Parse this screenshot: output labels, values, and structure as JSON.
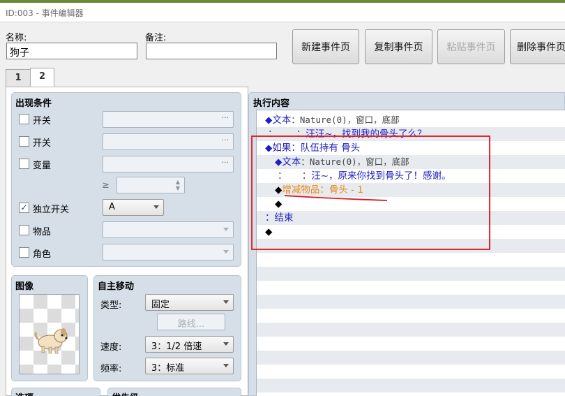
{
  "window": {
    "title": "ID:003 - 事件编辑器"
  },
  "header": {
    "name_label": "名称:",
    "name_value": "狗子",
    "note_label": "备注:",
    "note_value": ""
  },
  "toolbar": {
    "new_page": "新建事件页",
    "copy_page": "复制事件页",
    "paste_page": "粘贴事件页",
    "delete_page": "删除事件页"
  },
  "tabs": [
    {
      "label": "1"
    },
    {
      "label": "2"
    }
  ],
  "conditions": {
    "title": "出现条件",
    "switch1_label": "开关",
    "switch2_label": "开关",
    "variable_label": "变量",
    "gte_symbol": "≥",
    "self_switch_label": "独立开关",
    "self_switch_value": "A",
    "item_label": "物品",
    "actor_label": "角色",
    "ellipsis": "···"
  },
  "image": {
    "title": "图像"
  },
  "autonomous": {
    "title": "自主移动",
    "type_label": "类型:",
    "type_value": "固定",
    "route_button": "路线...",
    "speed_label": "速度:",
    "speed_value": "3：1/2 倍速",
    "freq_label": "频率:",
    "freq_value": "3：标准"
  },
  "bottom_groups": {
    "options": "选项",
    "priority": "优先级"
  },
  "contents": {
    "title": "执行内容",
    "lines": {
      "l1_cmd": "◆文本",
      "l1_params": "：Nature(0)，窗口，底部",
      "l2_prefix": "：",
      "l2_cont": "：",
      "l2_text": "汪汪~，找到我的骨头了么？",
      "l3": "◆如果：队伍持有 骨头",
      "l4_cmd": "◆文本",
      "l4_params": "：Nature(0)，窗口，底部",
      "l5_prefix": "：",
      "l5_cont": "：",
      "l5_text": "汪~，原来你找到骨头了！感谢。",
      "l6_diamond": "◆",
      "l6_cmd": "增减物品：骨头 - 1",
      "l7": "◆",
      "l8": "：结束",
      "l9": "◆"
    }
  },
  "colors": {
    "command_blue": "#1f1fbf",
    "item_orange": "#e88a1a",
    "annotation_red": "#e0151d"
  }
}
